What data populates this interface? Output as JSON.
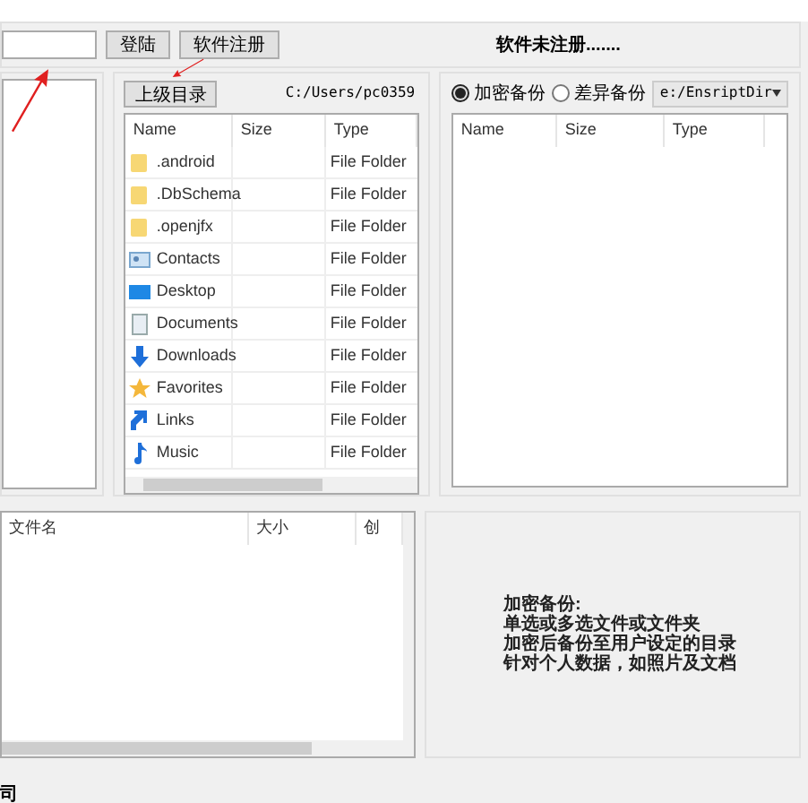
{
  "login": {
    "buttons": [
      "登陆",
      "软件注册"
    ],
    "status": "软件未注册......."
  },
  "browser": {
    "up_button": "上级目录",
    "path": "C:/Users/pc0359",
    "columns": [
      "Name",
      "Size",
      "Type"
    ],
    "rows": [
      {
        "name": ".android",
        "type": "File Folder",
        "kind": "folder"
      },
      {
        "name": ".DbSchema",
        "type": "File Folder",
        "kind": "folder"
      },
      {
        "name": ".openjfx",
        "type": "File Folder",
        "kind": "folder"
      },
      {
        "name": "Contacts",
        "type": "File Folder",
        "kind": "contacts"
      },
      {
        "name": "Desktop",
        "type": "File Folder",
        "kind": "desktop"
      },
      {
        "name": "Documents",
        "type": "File Folder",
        "kind": "documents"
      },
      {
        "name": "Downloads",
        "type": "File Folder",
        "kind": "downloads"
      },
      {
        "name": "Favorites",
        "type": "File Folder",
        "kind": "favorites"
      },
      {
        "name": "Links",
        "type": "File Folder",
        "kind": "links"
      },
      {
        "name": "Music",
        "type": "File Folder",
        "kind": "music"
      }
    ]
  },
  "backup": {
    "modes": [
      {
        "label": "加密备份",
        "selected": true
      },
      {
        "label": "差异备份",
        "selected": false
      }
    ],
    "dir": "e:/EnsriptDir",
    "columns": [
      "Name",
      "Size",
      "Type"
    ]
  },
  "queue": {
    "columns": [
      "文件名",
      "大小",
      "创"
    ]
  },
  "info": {
    "lines": [
      "加密备份:",
      "单选或多选文件或文件夹",
      "加密后备份至用户设定的目录",
      "针对个人数据，如照片及文档"
    ]
  },
  "status_bar": "司"
}
